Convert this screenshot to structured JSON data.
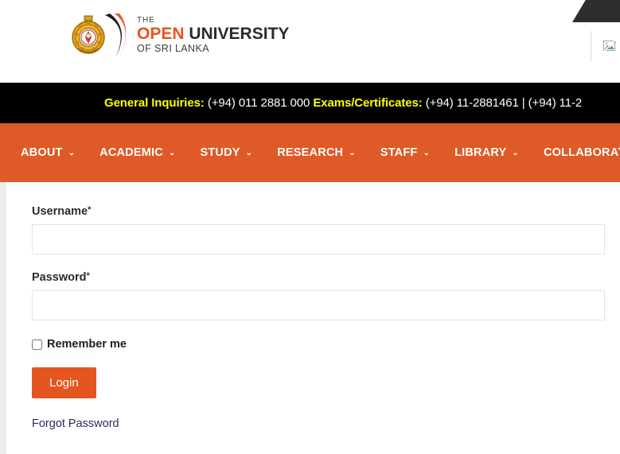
{
  "header": {
    "logo": {
      "line_the": "THE",
      "word_open": "OPEN",
      "word_university": " UNIVERSITY",
      "line_sub": "OF SRI LANKA",
      "crest_icon": "university-crest-icon",
      "swoosh_icon": "logo-swoosh-icon"
    },
    "right": {
      "broken_image_icon": "broken-image-icon"
    },
    "corner_tab_icon": "corner-tab-shape"
  },
  "contact_bar": {
    "general_label": "General Inquiries:",
    "general_value": " (+94) 011 2881 000 ",
    "exams_label": "Exams/Certificates:",
    "exams_value": " (+94) 11-2881461 | (+94) 11-2"
  },
  "nav": {
    "items": [
      {
        "label": "ABOUT",
        "caret": "⌄"
      },
      {
        "label": "ACADEMIC",
        "caret": "⌄"
      },
      {
        "label": "STUDY",
        "caret": "⌄"
      },
      {
        "label": "RESEARCH",
        "caret": "⌄"
      },
      {
        "label": "STAFF",
        "caret": "⌄"
      },
      {
        "label": "LIBRARY",
        "caret": "⌄"
      },
      {
        "label": "COLLABORATE",
        "caret": "⌄"
      }
    ]
  },
  "login_form": {
    "username_label": "Username",
    "username_required": "*",
    "username_value": "",
    "username_placeholder": "",
    "password_label": "Password",
    "password_required": "*",
    "password_value": "",
    "password_placeholder": "",
    "remember_label": "Remember me",
    "remember_checked": false,
    "login_button": "Login",
    "forgot_link": "Forgot Password"
  },
  "colors": {
    "brand_orange": "#df5a26",
    "button_orange": "#e4551f",
    "logo_orange": "#e9541f",
    "banner_black": "#000000",
    "banner_yellow": "#ffff00",
    "link_navy": "#2a2a5e",
    "page_gray": "#ececec",
    "corner_dark": "#2e2e2e"
  }
}
